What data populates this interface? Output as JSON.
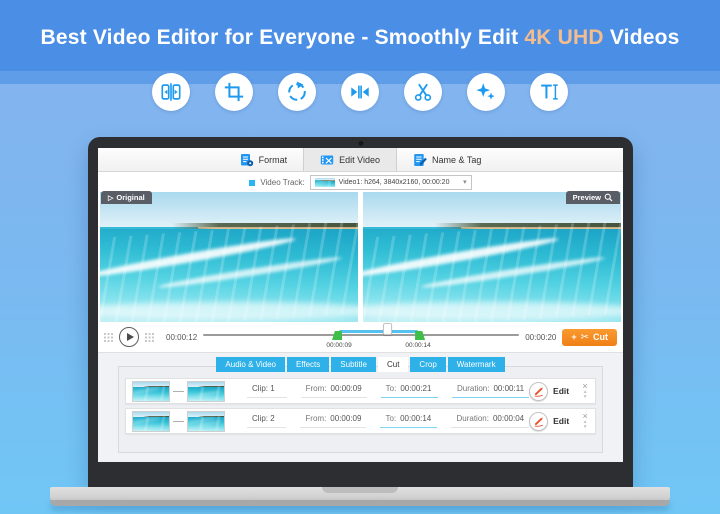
{
  "colors": {
    "accent_blue": "#2eb0e9",
    "icon_blue": "#1d9aee",
    "highlight_orange": "#f3bd8d",
    "cut_orange": "#f5871f",
    "handle_green": "#3fbf4a",
    "edit_red": "#e8502a"
  },
  "banner": {
    "title_prefix": "Best Video Editor for Everyone - Smoothly Edit ",
    "title_highlight": "4K UHD",
    "title_suffix": " Videos"
  },
  "feature_icons": [
    {
      "name": "split-icon"
    },
    {
      "name": "crop-icon"
    },
    {
      "name": "rotate-icon"
    },
    {
      "name": "trim-icon"
    },
    {
      "name": "scissors-icon"
    },
    {
      "name": "effects-icon"
    },
    {
      "name": "text-icon"
    }
  ],
  "editor": {
    "tabs": [
      {
        "label": "Format"
      },
      {
        "label": "Edit Video"
      },
      {
        "label": "Name & Tag"
      }
    ],
    "track_bar": {
      "original_label": "Original",
      "play_glyph": "▷",
      "video_track_label": "Video Track:",
      "track_value": "Video1: h264, 3840x2160, 00:00:20",
      "caret_glyph": "▾",
      "preview_label": "Preview"
    },
    "playback": {
      "current_time": "00:00:12",
      "total_time": "00:00:20",
      "trim_start": "00:00:09",
      "trim_end": "00:00:14",
      "cut_plus": "+",
      "cut_scissors": "✂",
      "cut_label": "Cut"
    },
    "edit_tabs": [
      {
        "label": "Audio & Video"
      },
      {
        "label": "Effects"
      },
      {
        "label": "Subtitle"
      },
      {
        "label": "Cut"
      },
      {
        "label": "Crop"
      },
      {
        "label": "Watermark"
      }
    ],
    "clips": [
      {
        "clip_label": "Clip: 1",
        "from_label": "From:",
        "from_value": "00:00:09",
        "to_label": "To:",
        "to_value": "00:00:21",
        "duration_label": "Duration:",
        "duration_value": "00:00:11",
        "edit_label": "Edit",
        "close_glyph": "×",
        "up_glyph": "▲",
        "down_glyph": "▼"
      },
      {
        "clip_label": "Clip: 2",
        "from_label": "From:",
        "from_value": "00:00:09",
        "to_label": "To:",
        "to_value": "00:00:14",
        "duration_label": "Duration:",
        "duration_value": "00:00:04",
        "edit_label": "Edit",
        "close_glyph": "×",
        "up_glyph": "▲",
        "down_glyph": "▼"
      }
    ]
  }
}
